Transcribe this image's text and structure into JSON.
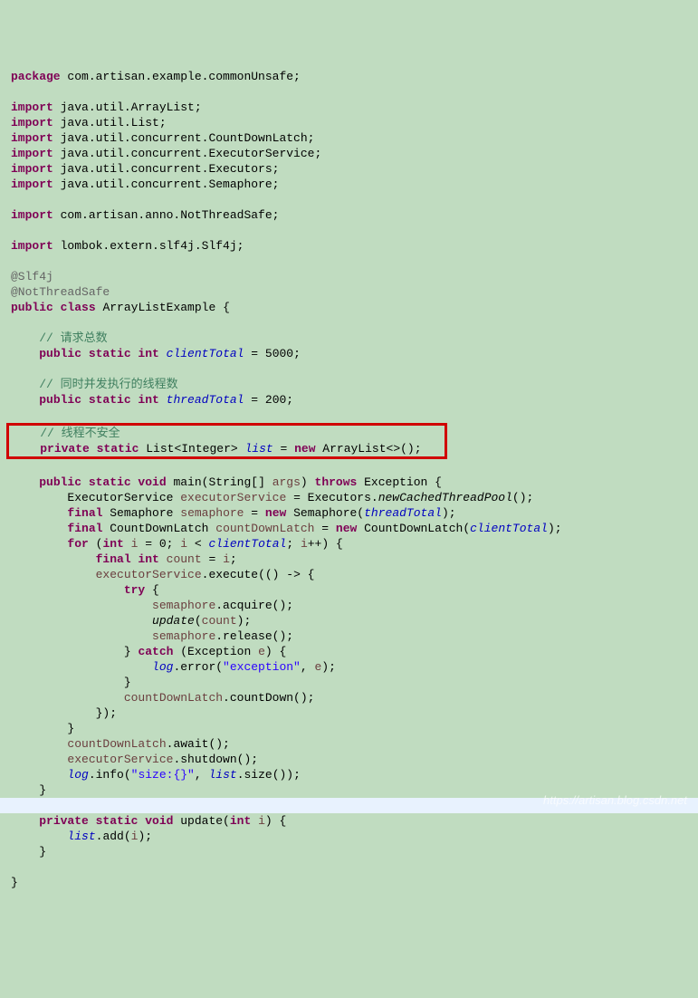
{
  "pkg": {
    "kw": "package",
    "name": " com.artisan.example.commonUnsafe;"
  },
  "imports": [
    {
      "kw": "import",
      "name": " java.util.ArrayList;"
    },
    {
      "kw": "import",
      "name": " java.util.List;"
    },
    {
      "kw": "import",
      "name": " java.util.concurrent.CountDownLatch;"
    },
    {
      "kw": "import",
      "name": " java.util.concurrent.ExecutorService;"
    },
    {
      "kw": "import",
      "name": " java.util.concurrent.Executors;"
    },
    {
      "kw": "import",
      "name": " java.util.concurrent.Semaphore;"
    }
  ],
  "import2": {
    "kw": "import",
    "name": " com.artisan.anno.NotThreadSafe;"
  },
  "import3": {
    "kw": "import",
    "name": " lombok.extern.slf4j.Slf4j;"
  },
  "ann1": "@Slf4j",
  "ann2": "@NotThreadSafe",
  "classDecl": {
    "pub": "public",
    "cls": "class",
    "name": " ArrayListExample {"
  },
  "cmt1": "// 请求总数",
  "f1": {
    "mods": "public static int ",
    "name": "clientTotal",
    "rest": " = 5000;"
  },
  "cmt2": "// 同时并发执行的线程数",
  "f2": {
    "mods": "public static int ",
    "name": "threadTotal",
    "rest": " = 200;"
  },
  "cmt3": "// 线程不安全",
  "f3": {
    "mods": "private static ",
    "type": "List<Integer> ",
    "name": "list",
    "eq": " = ",
    "new": "new",
    "rest": " ArrayList<>();"
  },
  "main": {
    "sig1": "public static void",
    "sig2": " main(String[] ",
    "arg": "args",
    "sig3": ") ",
    "thr": "throws",
    "sig4": " Exception {",
    "l1a": "        ExecutorService ",
    "l1b": "executorService",
    "l1c": " = Executors.",
    "l1d": "newCachedThreadPool",
    "l1e": "();",
    "l2a": "        ",
    "l2b": "final",
    "l2c": " Semaphore ",
    "l2d": "semaphore",
    "l2e": " = ",
    "l2f": "new",
    "l2g": " Semaphore(",
    "l2h": "threadTotal",
    "l2i": ");",
    "l3a": "        ",
    "l3b": "final",
    "l3c": " CountDownLatch ",
    "l3d": "countDownLatch",
    "l3e": " = ",
    "l3f": "new",
    "l3g": " CountDownLatch(",
    "l3h": "clientTotal",
    "l3i": ");",
    "l4a": "        ",
    "l4b": "for",
    "l4c": " (",
    "l4d": "int",
    "l4e": " ",
    "l4f": "i",
    "l4g": " = 0; ",
    "l4h": "i",
    "l4i": " < ",
    "l4j": "clientTotal",
    "l4k": "; ",
    "l4l": "i",
    "l4m": "++) {",
    "l5a": "            ",
    "l5b": "final int ",
    "l5c": "count",
    "l5d": " = ",
    "l5e": "i",
    "l5f": ";",
    "l6a": "            ",
    "l6b": "executorService",
    "l6c": ".execute(() -> {",
    "l7a": "                ",
    "l7b": "try",
    "l7c": " {",
    "l8a": "                    ",
    "l8b": "semaphore",
    "l8c": ".acquire();",
    "l9a": "                    ",
    "l9b": "update",
    "l9c": "(",
    "l9d": "count",
    "l9e": ");",
    "l10a": "                    ",
    "l10b": "semaphore",
    "l10c": ".release();",
    "l11a": "                } ",
    "l11b": "catch",
    "l11c": " (Exception ",
    "l11d": "e",
    "l11e": ") {",
    "l12a": "                    ",
    "l12b": "log",
    "l12c": ".error(",
    "l12d": "\"exception\"",
    "l12e": ", ",
    "l12f": "e",
    "l12g": ");",
    "l13": "                }",
    "l14a": "                ",
    "l14b": "countDownLatch",
    "l14c": ".countDown();",
    "l15": "            });",
    "l16": "        }",
    "l17a": "        ",
    "l17b": "countDownLatch",
    "l17c": ".await();",
    "l18a": "        ",
    "l18b": "executorService",
    "l18c": ".shutdown();",
    "l19a": "        ",
    "l19b": "log",
    "l19c": ".info(",
    "l19d": "\"size:{}\"",
    "l19e": ", ",
    "l19f": "list",
    "l19g": ".size());",
    "l20": "    }"
  },
  "upd": {
    "sig1": "private static void",
    "sig2": " update(",
    "sig3": "int",
    "sig4": " ",
    "arg": "i",
    "sig5": ") {",
    "b1a": "        ",
    "b1b": "list",
    "b1c": ".add(",
    "b1d": "i",
    "b1e": ");",
    "b2": "    }"
  },
  "close": "}",
  "watermark": "https://artisan.blog.csdn.net"
}
